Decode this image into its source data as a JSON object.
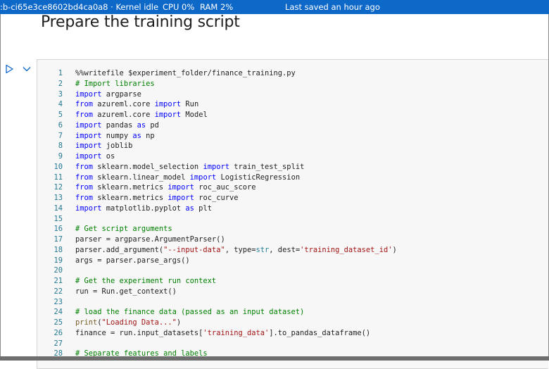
{
  "status_bar": {
    "compute": ":b-ci65e3ce8602bd4ca0a8 · Kernel idle",
    "cpu": "CPU  0%",
    "ram": "RAM  2%",
    "saved": "Last saved an hour ago"
  },
  "heading": "Prepare the training script",
  "cell_toolbar": {
    "run_icon": "run-cell-icon",
    "collapse_icon": "chevron-down-icon"
  },
  "colors": {
    "status_bar": "#0e68c8",
    "keyword": "#0000ff",
    "comment": "#008000",
    "string": "#a31515",
    "line_number": "#237893"
  },
  "code_lines": [
    {
      "n": "1",
      "t": [
        [
          "%%writefile $experiment_folder/finance_training.py",
          ""
        ]
      ]
    },
    {
      "n": "2",
      "t": [
        [
          "# Import libraries",
          "cm"
        ]
      ]
    },
    {
      "n": "3",
      "t": [
        [
          "import",
          "kw"
        ],
        [
          " argparse",
          ""
        ]
      ]
    },
    {
      "n": "4",
      "t": [
        [
          "from",
          "kw"
        ],
        [
          " azureml.core ",
          ""
        ],
        [
          "import",
          "kw"
        ],
        [
          " Run",
          ""
        ]
      ]
    },
    {
      "n": "5",
      "t": [
        [
          "from",
          "kw"
        ],
        [
          " azureml.core ",
          ""
        ],
        [
          "import",
          "kw"
        ],
        [
          " Model",
          ""
        ]
      ]
    },
    {
      "n": "6",
      "t": [
        [
          "import",
          "kw"
        ],
        [
          " pandas ",
          ""
        ],
        [
          "as",
          "kw"
        ],
        [
          " pd",
          ""
        ]
      ]
    },
    {
      "n": "7",
      "t": [
        [
          "import",
          "kw"
        ],
        [
          " numpy ",
          ""
        ],
        [
          "as",
          "kw"
        ],
        [
          " np",
          ""
        ]
      ]
    },
    {
      "n": "8",
      "t": [
        [
          "import",
          "kw"
        ],
        [
          " joblib",
          ""
        ]
      ]
    },
    {
      "n": "9",
      "t": [
        [
          "import",
          "kw"
        ],
        [
          " os",
          ""
        ]
      ]
    },
    {
      "n": "10",
      "t": [
        [
          "from",
          "kw"
        ],
        [
          " sklearn.model_selection ",
          ""
        ],
        [
          "import",
          "kw"
        ],
        [
          " train_test_split",
          ""
        ]
      ]
    },
    {
      "n": "11",
      "t": [
        [
          "from",
          "kw"
        ],
        [
          " sklearn.linear_model ",
          ""
        ],
        [
          "import",
          "kw"
        ],
        [
          " LogisticRegression",
          ""
        ]
      ]
    },
    {
      "n": "12",
      "t": [
        [
          "from",
          "kw"
        ],
        [
          " sklearn.metrics ",
          ""
        ],
        [
          "import",
          "kw"
        ],
        [
          " roc_auc_score",
          ""
        ]
      ]
    },
    {
      "n": "13",
      "t": [
        [
          "from",
          "kw"
        ],
        [
          " sklearn.metrics ",
          ""
        ],
        [
          "import",
          "kw"
        ],
        [
          " roc_curve",
          ""
        ]
      ]
    },
    {
      "n": "14",
      "t": [
        [
          "import",
          "kw"
        ],
        [
          " matplotlib.pyplot ",
          ""
        ],
        [
          "as",
          "kw"
        ],
        [
          " plt",
          ""
        ]
      ]
    },
    {
      "n": "15",
      "t": []
    },
    {
      "n": "16",
      "t": [
        [
          "# Get script arguments",
          "cm"
        ]
      ]
    },
    {
      "n": "17",
      "t": [
        [
          "parser = argparse.ArgumentParser()",
          ""
        ]
      ]
    },
    {
      "n": "18",
      "t": [
        [
          "parser.add_argument(",
          ""
        ],
        [
          "\"--input-data\"",
          "st"
        ],
        [
          ", type=",
          ""
        ],
        [
          "str",
          "bi"
        ],
        [
          ", dest=",
          ""
        ],
        [
          "'training_dataset_id'",
          "st"
        ],
        [
          ")",
          ""
        ]
      ]
    },
    {
      "n": "19",
      "t": [
        [
          "args = parser.parse_args()",
          ""
        ]
      ]
    },
    {
      "n": "20",
      "t": []
    },
    {
      "n": "21",
      "t": [
        [
          "# Get the experiment run context",
          "cm"
        ]
      ]
    },
    {
      "n": "22",
      "t": [
        [
          "run = Run.get_context()",
          ""
        ]
      ]
    },
    {
      "n": "23",
      "t": []
    },
    {
      "n": "24",
      "t": [
        [
          "# load the finance data (passed as an input dataset)",
          "cm"
        ]
      ]
    },
    {
      "n": "25",
      "t": [
        [
          "print",
          "fn"
        ],
        [
          "(",
          ""
        ],
        [
          "\"Loading Data...\"",
          "st"
        ],
        [
          ")",
          ""
        ]
      ]
    },
    {
      "n": "26",
      "t": [
        [
          "finance = run.input_datasets[",
          ""
        ],
        [
          "'training_data'",
          "st"
        ],
        [
          "].to_pandas_dataframe()",
          ""
        ]
      ]
    },
    {
      "n": "27",
      "t": []
    },
    {
      "n": "28",
      "t": [
        [
          "# Separate features and labels",
          "cm"
        ]
      ]
    }
  ]
}
